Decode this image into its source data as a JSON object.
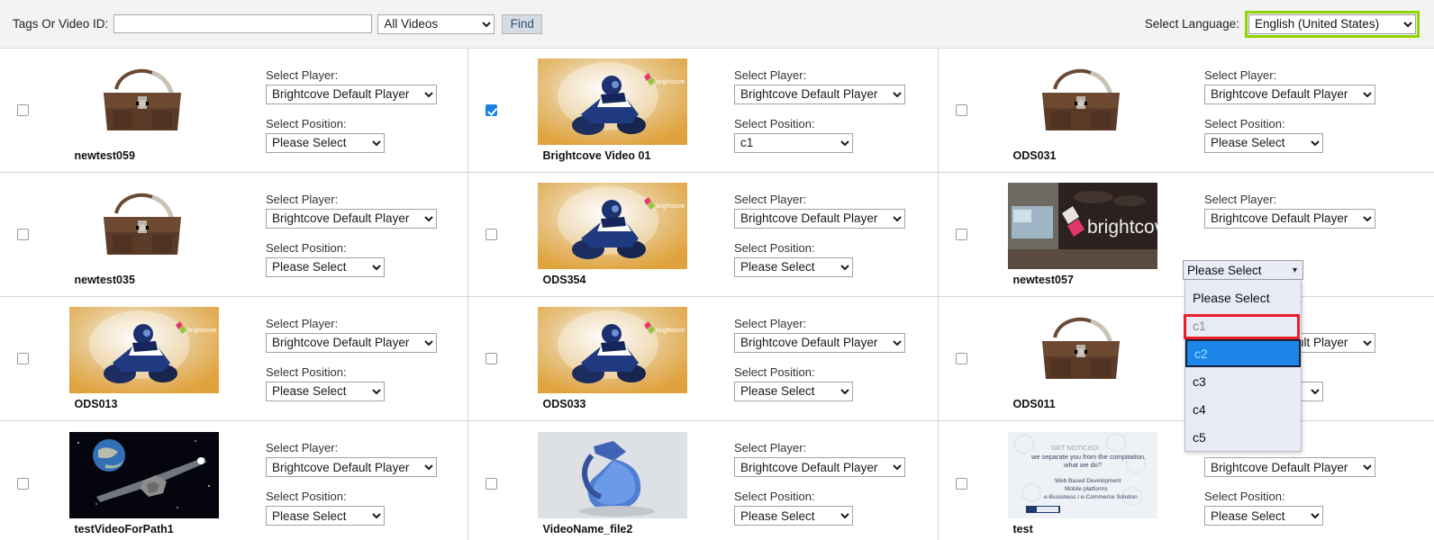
{
  "toolbar": {
    "tags_label": "Tags Or Video ID:",
    "search_value": "",
    "search_placeholder": "",
    "filter_selected": "All Videos",
    "filter_options": [
      "All Videos"
    ],
    "find_label": "Find",
    "language_label": "Select Language:",
    "language_selected": "English (United States)",
    "language_highlight_color": "#8fd400"
  },
  "labels": {
    "select_player": "Select Player:",
    "select_position": "Select Position:"
  },
  "defaults": {
    "player": "Brightcove Default Player",
    "position": "Please Select"
  },
  "open_dropdown": {
    "field_label": "Select Position:",
    "current_value": "Please Select",
    "options": [
      "Please Select",
      "c1",
      "c2",
      "c3",
      "c4",
      "c5"
    ],
    "disabled_option": "c1",
    "highlighted_option": "c2",
    "annotation_color": "#ee1c25",
    "selection_color": "#1e86e8"
  },
  "rows": [
    {
      "cells": [
        {
          "checked": false,
          "name": "newtest059",
          "player": "Brightcove Default Player",
          "position": "Please Select",
          "art": "bag"
        },
        {
          "checked": true,
          "name": "Brightcove Video 01",
          "player": "Brightcove Default Player",
          "position": "c1",
          "art": "atv"
        },
        {
          "checked": false,
          "name": "ODS031",
          "player": "Brightcove Default Player",
          "position": "Please Select",
          "art": "bag"
        }
      ]
    },
    {
      "cells": [
        {
          "checked": false,
          "name": "newtest035",
          "player": "Brightcove Default Player",
          "position": "Please Select",
          "art": "bag"
        },
        {
          "checked": false,
          "name": "ODS354",
          "player": "Brightcove Default Player",
          "position": "Please Select",
          "art": "atv"
        },
        {
          "checked": false,
          "name": "newtest057",
          "player": "Brightcove Default Player",
          "position": "Please Select",
          "art": "office"
        }
      ]
    },
    {
      "cells": [
        {
          "checked": false,
          "name": "ODS013",
          "player": "Brightcove Default Player",
          "position": "Please Select",
          "art": "atv"
        },
        {
          "checked": false,
          "name": "ODS033",
          "player": "Brightcove Default Player",
          "position": "Please Select",
          "art": "atv"
        },
        {
          "checked": false,
          "name": "ODS011",
          "player": "Brightcove Default Player",
          "position": "Please Select",
          "art": "bag"
        }
      ]
    },
    {
      "cells": [
        {
          "checked": false,
          "name": "testVideoForPath1",
          "player": "Brightcove Default Player",
          "position": "Please Select",
          "art": "space"
        },
        {
          "checked": false,
          "name": "VideoName_file2",
          "player": "Brightcove Default Player",
          "position": "Please Select",
          "art": "tie"
        },
        {
          "checked": false,
          "name": "test",
          "player": "Brightcove Default Player",
          "position": "Please Select",
          "art": "slide"
        }
      ]
    }
  ]
}
